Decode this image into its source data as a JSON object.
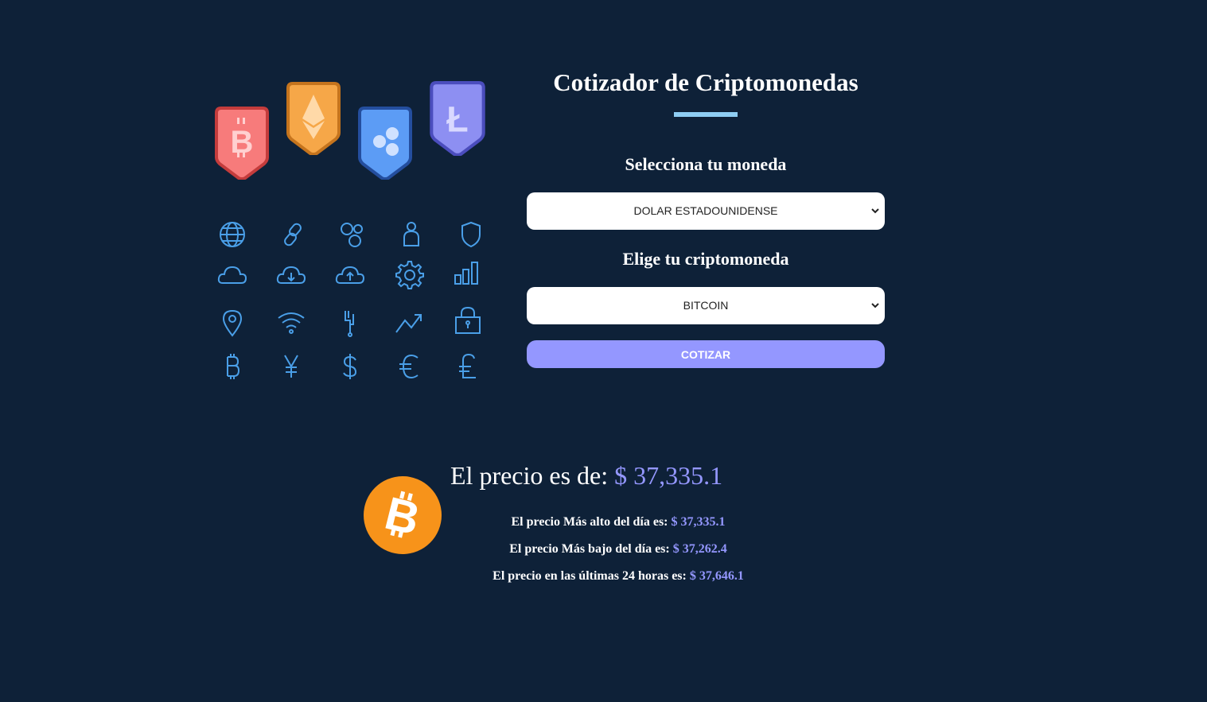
{
  "header": {
    "title": "Cotizador de Criptomonedas"
  },
  "form": {
    "currency_label": "Selecciona tu moneda",
    "currency_value": "DOLAR ESTADOUNIDENSE",
    "crypto_label": "Elige tu criptomoneda",
    "crypto_value": "BITCOIN",
    "submit_label": "COTIZAR"
  },
  "result": {
    "price_label": "El precio es de:",
    "price_value": "$ 37,335.1",
    "high_label": "El precio Más alto del día es:",
    "high_value": "$ 37,335.1",
    "low_label": "El precio Más bajo del día es:",
    "low_value": "$ 37,262.4",
    "last24_label": "El precio en las últimas 24 horas es:",
    "last24_value": "$ 37,646.1"
  },
  "illustration": {
    "badges": [
      "bitcoin-badge-icon",
      "ethereum-badge-icon",
      "ripple-badge-icon",
      "litecoin-badge-icon"
    ],
    "icons": [
      "globe-icon",
      "link-icon",
      "nodes-icon",
      "user-icon",
      "shield-icon",
      "cloud-icon",
      "cloud-download-icon",
      "cloud-upload-icon",
      "gear-icon",
      "bar-chart-icon",
      "location-pin-icon",
      "wifi-icon",
      "plug-icon",
      "trend-up-icon",
      "lock-icon",
      "bitcoin-icon",
      "yen-icon",
      "dollar-icon",
      "euro-icon",
      "pound-icon"
    ]
  },
  "colors": {
    "background": "#0e2138",
    "accent": "#9497ff",
    "underline": "#8ecdf3",
    "icon": "#4a9fe8",
    "bitcoin_coin": "#f7931a"
  }
}
